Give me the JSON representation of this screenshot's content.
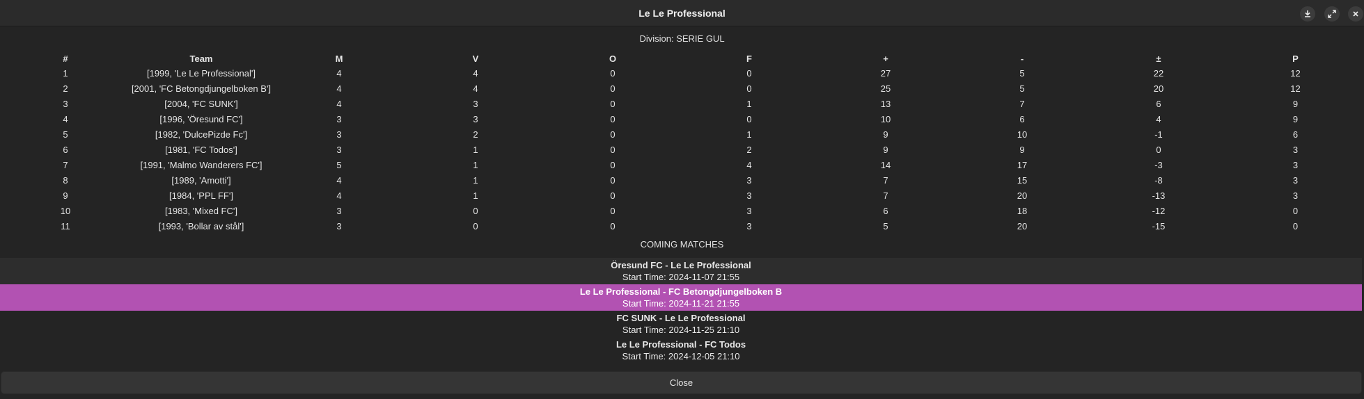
{
  "window": {
    "title": "Le Le Professional",
    "controls": [
      "download-icon",
      "fullscreen-icon",
      "close-icon"
    ]
  },
  "division_label": "Division: SERIE GUL",
  "standings": {
    "headers": [
      "#",
      "Team",
      "M",
      "V",
      "O",
      "F",
      "+",
      "-",
      "±",
      "P"
    ],
    "rows": [
      [
        "1",
        "[1999, 'Le Le Professional']",
        "4",
        "4",
        "0",
        "0",
        "27",
        "5",
        "22",
        "12"
      ],
      [
        "2",
        "[2001, 'FC Betongdjungelboken B']",
        "4",
        "4",
        "0",
        "0",
        "25",
        "5",
        "20",
        "12"
      ],
      [
        "3",
        "[2004, 'FC SUNK']",
        "4",
        "3",
        "0",
        "1",
        "13",
        "7",
        "6",
        "9"
      ],
      [
        "4",
        "[1996, 'Öresund FC']",
        "3",
        "3",
        "0",
        "0",
        "10",
        "6",
        "4",
        "9"
      ],
      [
        "5",
        "[1982, 'DulcePizde Fc']",
        "3",
        "2",
        "0",
        "1",
        "9",
        "10",
        "-1",
        "6"
      ],
      [
        "6",
        "[1981, 'FC Todos']",
        "3",
        "1",
        "0",
        "2",
        "9",
        "9",
        "0",
        "3"
      ],
      [
        "7",
        "[1991, 'Malmo Wanderers FC']",
        "5",
        "1",
        "0",
        "4",
        "14",
        "17",
        "-3",
        "3"
      ],
      [
        "8",
        "[1989, 'Amotti']",
        "4",
        "1",
        "0",
        "3",
        "7",
        "15",
        "-8",
        "3"
      ],
      [
        "9",
        "[1984, 'PPL FF']",
        "4",
        "1",
        "0",
        "3",
        "7",
        "20",
        "-13",
        "3"
      ],
      [
        "10",
        "[1983, 'Mixed FC']",
        "3",
        "0",
        "0",
        "3",
        "6",
        "18",
        "-12",
        "0"
      ],
      [
        "11",
        "[1993, 'Bollar av stål']",
        "3",
        "0",
        "0",
        "3",
        "5",
        "20",
        "-15",
        "0"
      ]
    ]
  },
  "coming_matches": {
    "title": "COMING MATCHES",
    "items": [
      {
        "teams": "Öresund FC - Le Le Professional",
        "time": "Start Time: 2024-11-07 21:55"
      },
      {
        "teams": "Le Le Professional - FC Betongdjungelboken B",
        "time": "Start Time: 2024-11-21 21:55"
      },
      {
        "teams": "FC SUNK - Le Le Professional",
        "time": "Start Time: 2024-11-25 21:10"
      },
      {
        "teams": "Le Le Professional - FC Todos",
        "time": "Start Time: 2024-12-05 21:10"
      }
    ],
    "selected_index": 1,
    "selected_color": "#b252b2"
  },
  "close_label": "Close"
}
